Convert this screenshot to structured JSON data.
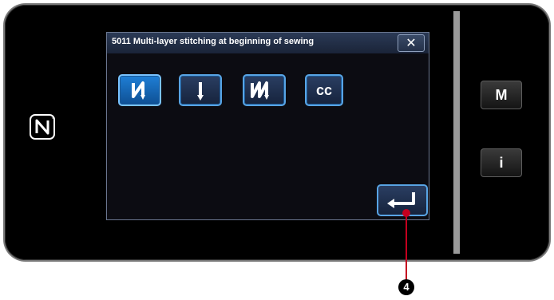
{
  "dialog": {
    "title": "5011 Multi-layer stitching at beginning of sewing",
    "close_label": "✕"
  },
  "options": [
    {
      "icon": "zigzag-stitch-icon",
      "selected": true
    },
    {
      "icon": "straight-down-icon",
      "selected": false
    },
    {
      "icon": "multi-zigzag-stitch-icon",
      "selected": false
    },
    {
      "label": "cc",
      "selected": false
    }
  ],
  "enter_button": {
    "icon": "enter-arrow-icon"
  },
  "side_buttons": {
    "menu_label": "M",
    "info_label": "i"
  },
  "callout": {
    "number": "4"
  },
  "colors": {
    "accent": "#58a4e4",
    "selected": "#1f7fd6",
    "callout": "#c4001f"
  }
}
